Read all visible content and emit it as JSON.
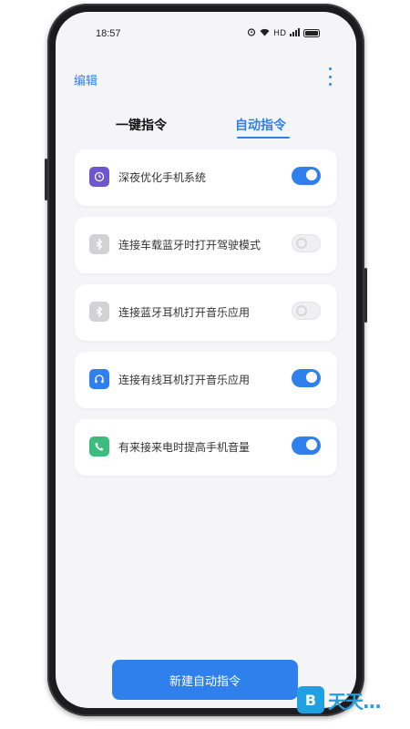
{
  "status_bar": {
    "time": "18:57",
    "icons": [
      "alarm-icon",
      "wifi-icon",
      "hd-icon",
      "signal-icon",
      "battery-icon"
    ],
    "hd_label": "HD"
  },
  "header": {
    "edit_label": "编辑",
    "more_icon": "more-vertical-icon"
  },
  "tabs": [
    {
      "label": "一键指令",
      "active": false
    },
    {
      "label": "自动指令",
      "active": true
    }
  ],
  "commands": [
    {
      "icon": "clock-icon",
      "icon_color": "#6e56cf",
      "label": "深夜优化手机系统",
      "enabled": true
    },
    {
      "icon": "bluetooth-icon",
      "icon_color": "#c7c7cc",
      "label": "连接车载蓝牙时打开驾驶模式",
      "enabled": false
    },
    {
      "icon": "bluetooth-icon",
      "icon_color": "#c7c7cc",
      "label": "连接蓝牙耳机打开音乐应用",
      "enabled": false
    },
    {
      "icon": "headset-icon",
      "icon_color": "#2f80ed",
      "label": "连接有线耳机打开音乐应用",
      "enabled": true
    },
    {
      "icon": "phone-icon",
      "icon_color": "#3dbd7d",
      "label": "有来接来电时提高手机音量",
      "enabled": true
    }
  ],
  "new_button_label": "新建自动指令",
  "watermark": {
    "badge": "B",
    "text": "天天..."
  },
  "colors": {
    "accent": "#2f80ed",
    "background": "#f5f5f7"
  }
}
